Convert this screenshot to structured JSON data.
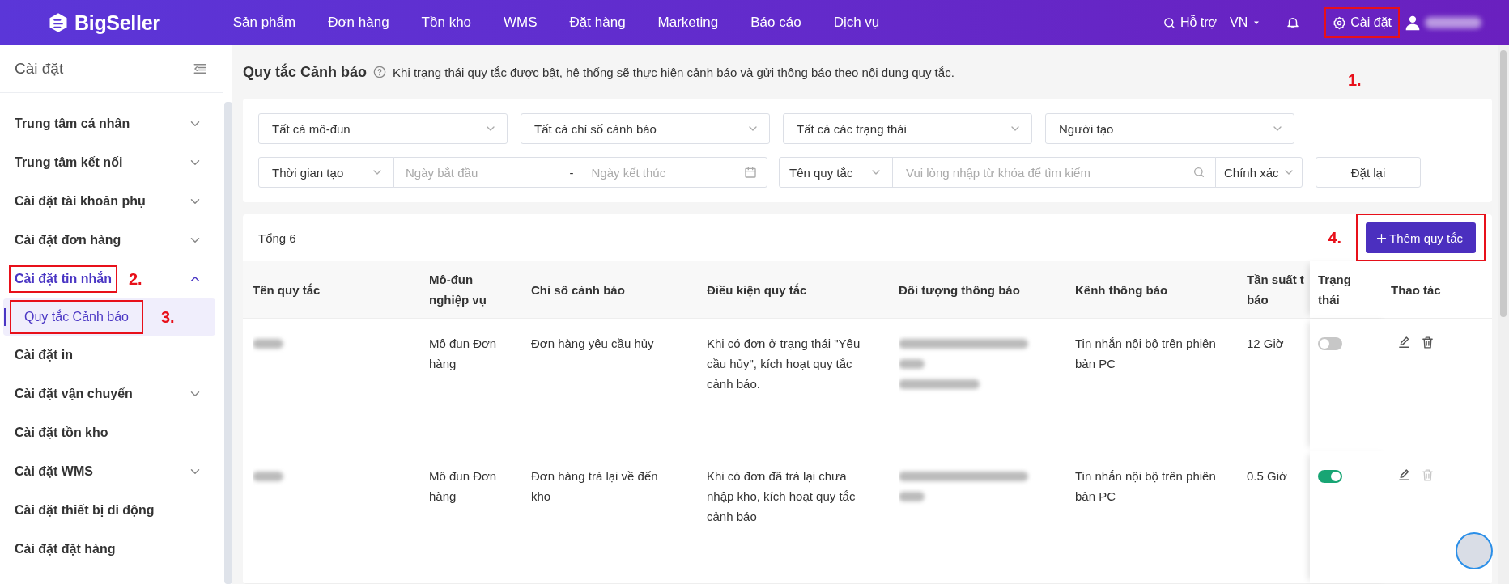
{
  "topbar": {
    "logo": "BigSeller",
    "nav": [
      {
        "label": "Sản phẩm"
      },
      {
        "label": "Đơn hàng"
      },
      {
        "label": "Tồn kho"
      },
      {
        "label": "WMS"
      },
      {
        "label": "Đặt hàng"
      },
      {
        "label": "Marketing"
      },
      {
        "label": "Báo cáo"
      },
      {
        "label": "Dịch vụ"
      }
    ],
    "support": "Hỗ trợ",
    "language": "VN",
    "settings": {
      "label": "Cài đặt",
      "annotated": true
    }
  },
  "sidebar": {
    "title": "Cài đặt",
    "items": [
      {
        "label": "Trung tâm cá nhân",
        "expandable": true,
        "expanded": false
      },
      {
        "label": "Trung tâm kết nối",
        "expandable": true,
        "expanded": false
      },
      {
        "label": "Cài đặt tài khoản phụ",
        "expandable": true,
        "expanded": false
      },
      {
        "label": "Cài đặt đơn hàng",
        "expandable": true,
        "expanded": false
      },
      {
        "label": "Cài đặt tin nhắn",
        "expandable": true,
        "expanded": true,
        "annotation": "2.",
        "children": [
          {
            "label": "Quy tắc Cảnh báo",
            "selected": true,
            "annotation": "3."
          }
        ]
      },
      {
        "label": "Cài đặt in",
        "expandable": false,
        "expanded": false
      },
      {
        "label": "Cài đặt vận chuyển",
        "expandable": true,
        "expanded": false
      },
      {
        "label": "Cài đặt tồn kho",
        "expandable": false,
        "expanded": false
      },
      {
        "label": "Cài đặt WMS",
        "expandable": true,
        "expanded": false
      },
      {
        "label": "Cài đặt thiết bị di động",
        "expandable": false,
        "expanded": false
      },
      {
        "label": "Cài đặt đặt hàng",
        "expandable": false,
        "expanded": false
      }
    ]
  },
  "page": {
    "title": "Quy tắc Cảnh báo",
    "hint": "Khi trạng thái quy tắc được bật, hệ thống sẽ thực hiện cảnh báo và gửi thông báo theo nội dung quy tắc.",
    "annotation": "1."
  },
  "filters": {
    "selects": [
      {
        "value": "Tất cả mô-đun"
      },
      {
        "value": "Tất cả chỉ số cảnh báo"
      },
      {
        "value": "Tất cả các trạng thái"
      },
      {
        "value": "Người tạo"
      }
    ],
    "time_type": "Thời gian tạo",
    "start_placeholder": "Ngày bắt đầu",
    "range_separator": "-",
    "end_placeholder": "Ngày kết thúc",
    "search_field": "Tên quy tắc",
    "search_placeholder": "Vui lòng nhập từ khóa để tìm kiếm",
    "match_mode": "Chính xác",
    "reset": "Đặt lại"
  },
  "table": {
    "total": "Tổng 6",
    "add_button": {
      "label": "Thêm quy tắc",
      "annotated": true,
      "annotation": "4."
    },
    "columns": [
      "Tên quy tắc",
      "Mô-đun\nnghiệp vụ",
      "Chỉ số cảnh báo",
      "Điều kiện quy tắc",
      "Đối tượng thông báo",
      "Kênh thông báo",
      "Tần suất t\nbáo",
      "Trạng\nthái",
      "Thao tác"
    ],
    "rows": [
      {
        "name_redacted": true,
        "module": "Mô đun Đơn hàng",
        "metric": "Đơn hàng yêu cầu hủy",
        "condition": "Khi có đơn ở trạng thái \"Yêu cầu hủy\", kích hoạt quy tắc cảnh báo.",
        "recipients": [
          {
            "redacted": true
          },
          {
            "redacted": true
          },
          {
            "redacted": true
          }
        ],
        "channel": "Tin nhắn nội bộ trên phiên bản PC",
        "frequency": "12 Giờ",
        "enabled": false,
        "delete_disabled": false
      },
      {
        "name_redacted": true,
        "module": "Mô đun Đơn hàng",
        "metric": "Đơn hàng trả lại về đến kho",
        "condition": "Khi có đơn đã trả lại chưa nhập kho, kích hoạt quy tắc cảnh báo",
        "recipients": [
          {
            "redacted": true
          },
          {
            "redacted": true
          }
        ],
        "channel": "Tin nhắn nội bộ trên phiên bản PC",
        "frequency": "0.5 Giờ",
        "enabled": true,
        "delete_disabled": true
      }
    ]
  }
}
